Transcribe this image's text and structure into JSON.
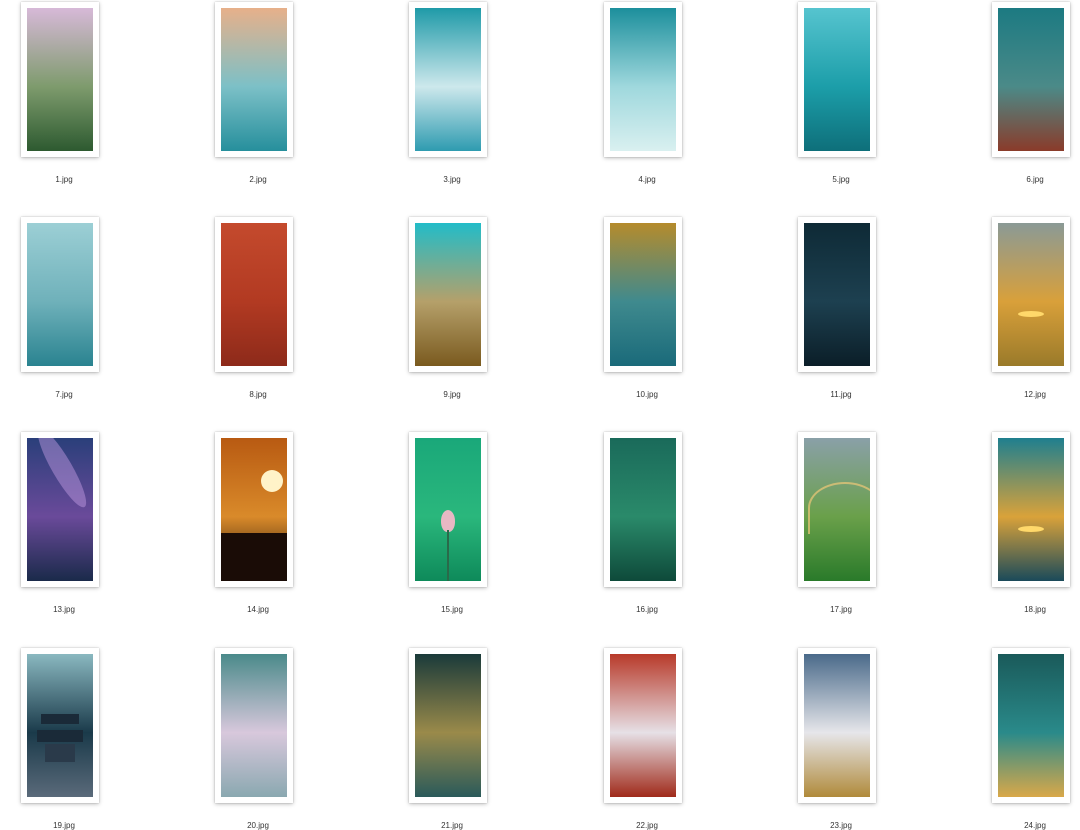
{
  "files": [
    {
      "name": "1.jpg",
      "colors": [
        "#d7b9d8",
        "#7e9b6d",
        "#2d5a30"
      ],
      "icon": "cherry-blossom-branch"
    },
    {
      "name": "2.jpg",
      "colors": [
        "#e7b08a",
        "#7cc0c7",
        "#268f9c"
      ],
      "icon": "frozen-sea-sunset"
    },
    {
      "name": "3.jpg",
      "colors": [
        "#1f9aa8",
        "#cde8ec",
        "#2e9bb0"
      ],
      "icon": "frosted-tree"
    },
    {
      "name": "4.jpg",
      "colors": [
        "#1c8f9c",
        "#9fd8dd",
        "#d9f0f0"
      ],
      "icon": "deer-on-snow"
    },
    {
      "name": "5.jpg",
      "colors": [
        "#56c4cf",
        "#1c9ea9",
        "#0e6f7a"
      ],
      "icon": "turquoise-ice"
    },
    {
      "name": "6.jpg",
      "colors": [
        "#1c7a82",
        "#4b8a88",
        "#8a3b2a"
      ],
      "icon": "palace-roof"
    },
    {
      "name": "7.jpg",
      "colors": [
        "#9ccfd5",
        "#6fb1ba",
        "#2a8390"
      ],
      "icon": "clouds-over-sea"
    },
    {
      "name": "8.jpg",
      "colors": [
        "#c44a2d",
        "#b23a22",
        "#8d2a1a"
      ],
      "icon": "persimmon-branch-red-wall"
    },
    {
      "name": "9.jpg",
      "colors": [
        "#22bcc8",
        "#b5a06a",
        "#7a5a1f"
      ],
      "icon": "mountain-valley"
    },
    {
      "name": "10.jpg",
      "colors": [
        "#b58b2c",
        "#3f8a8e",
        "#1a6a7a"
      ],
      "icon": "autumn-river"
    },
    {
      "name": "11.jpg",
      "colors": [
        "#0e2a36",
        "#1d4050",
        "#0b1e28"
      ],
      "icon": "pagoda-reflection"
    },
    {
      "name": "12.jpg",
      "colors": [
        "#8a9a96",
        "#d9a03a",
        "#9a7a2a"
      ],
      "icon": "sunset-field"
    },
    {
      "name": "13.jpg",
      "colors": [
        "#2a3f7a",
        "#6a4a9a",
        "#1a2a4a"
      ],
      "icon": "milky-way"
    },
    {
      "name": "14.jpg",
      "colors": [
        "#b85a12",
        "#d98a2a",
        "#1a0e08"
      ],
      "icon": "pagoda-sunset"
    },
    {
      "name": "15.jpg",
      "colors": [
        "#1aa87a",
        "#2ab77c",
        "#0e8a5a"
      ],
      "icon": "lotus-bud"
    },
    {
      "name": "16.jpg",
      "colors": [
        "#1a6a5a",
        "#2a8a6a",
        "#0e4a3a"
      ],
      "icon": "lotus-pond-boat"
    },
    {
      "name": "17.jpg",
      "colors": [
        "#8aa0a8",
        "#6aa04a",
        "#2a7a2a"
      ],
      "icon": "rainbow-grassland"
    },
    {
      "name": "18.jpg",
      "colors": [
        "#1f7f8f",
        "#d9a23a",
        "#1a4a5a"
      ],
      "icon": "sunset-wetland"
    },
    {
      "name": "19.jpg",
      "colors": [
        "#8ab8c0",
        "#1a3a4a",
        "#5a6a7a"
      ],
      "icon": "temple-of-heaven"
    },
    {
      "name": "20.jpg",
      "colors": [
        "#4a8a8a",
        "#d8c8dc",
        "#8aa8b0"
      ],
      "icon": "blossom-valley"
    },
    {
      "name": "21.jpg",
      "colors": [
        "#1a3a3a",
        "#9a8a4a",
        "#2a5a5a"
      ],
      "icon": "palace-eaves"
    },
    {
      "name": "22.jpg",
      "colors": [
        "#b83a2a",
        "#e6e0e6",
        "#a02a1a"
      ],
      "icon": "blossoms-red-wall"
    },
    {
      "name": "23.jpg",
      "colors": [
        "#4a6a8a",
        "#e6e6ea",
        "#b08a3a"
      ],
      "icon": "great-wall-clouds"
    },
    {
      "name": "24.jpg",
      "colors": [
        "#1a5a5a",
        "#2a8a8a",
        "#d9a84a"
      ],
      "icon": "bronze-lion"
    }
  ]
}
